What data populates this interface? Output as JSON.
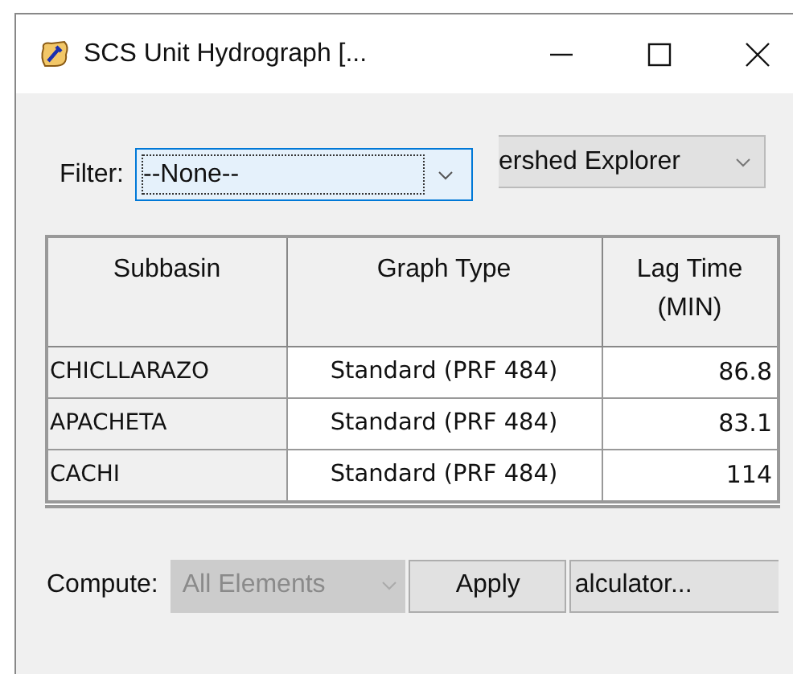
{
  "window": {
    "title": "SCS Unit Hydrograph [..."
  },
  "filter": {
    "label": "Filter:",
    "value": "--None--",
    "focused": true
  },
  "explorer_dropdown": {
    "value": "ershed Explorer"
  },
  "table": {
    "columns": [
      "Subbasin",
      "Graph Type",
      "Lag Time\n(MIN)"
    ],
    "rows": [
      [
        "CHICLLARAZO",
        "Standard (PRF 484)",
        "86.8"
      ],
      [
        "APACHETA",
        "Standard (PRF 484)",
        "83.1"
      ],
      [
        "CACHI",
        "Standard (PRF 484)",
        "114"
      ]
    ]
  },
  "compute": {
    "label": "Compute:",
    "value": "All Elements",
    "disabled": true
  },
  "buttons": [
    "Apply",
    "alculator..."
  ]
}
